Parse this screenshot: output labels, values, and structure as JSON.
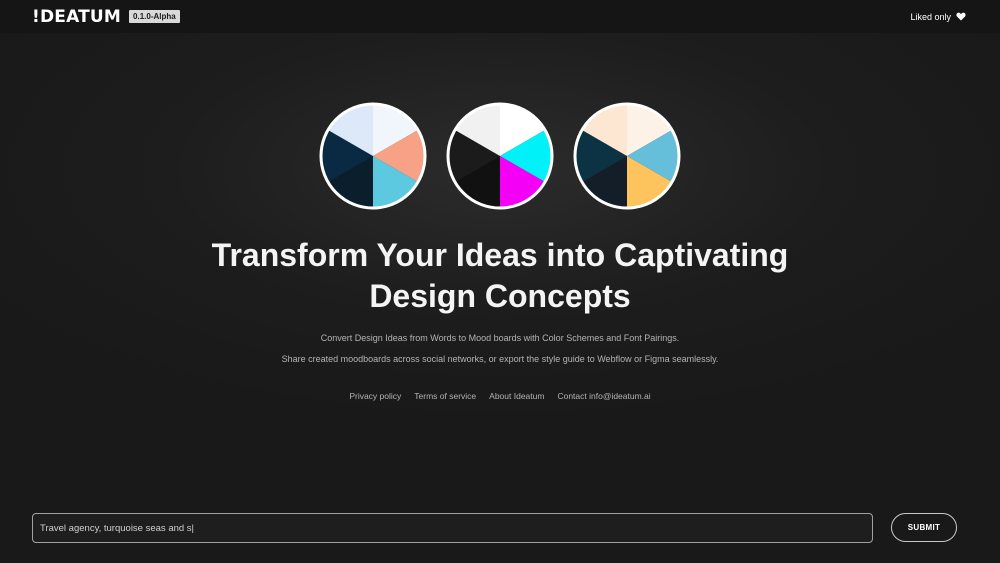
{
  "header": {
    "logo": "!DEATUM",
    "version": "0.1.0-Alpha",
    "liked_label": "Liked only",
    "liked_icon": "heart-icon"
  },
  "palettes": [
    {
      "name": "palette-1",
      "colors": [
        "#f1f6fd",
        "#f7a287",
        "#5dc9e0",
        "#0b1e2c",
        "#0a2942",
        "#dde9f8"
      ]
    },
    {
      "name": "palette-2",
      "colors": [
        "#ffffff",
        "#00f1f7",
        "#f500f7",
        "#111111",
        "#1b1b1b",
        "#f1f1f1"
      ]
    },
    {
      "name": "palette-3",
      "colors": [
        "#fdf2e8",
        "#65bfdb",
        "#fdc45e",
        "#141e28",
        "#0c3344",
        "#fde6d2"
      ]
    }
  ],
  "hero": {
    "headline_line1": "Transform Your Ideas into Captivating",
    "headline_line2": "Design Concepts",
    "sub1": "Convert Design Ideas from Words to Mood boards with Color Schemes and Font Pairings.",
    "sub2": "Share created moodboards across social networks, or export the style guide to Webflow or Figma seamlessly."
  },
  "footer_links": {
    "privacy": "Privacy policy",
    "terms": "Terms of service",
    "about": "About Ideatum",
    "contact": "Contact info@ideatum.ai"
  },
  "prompt": {
    "value": "Travel agency, turquoise seas and s|",
    "submit_label": "SUBMIT"
  }
}
